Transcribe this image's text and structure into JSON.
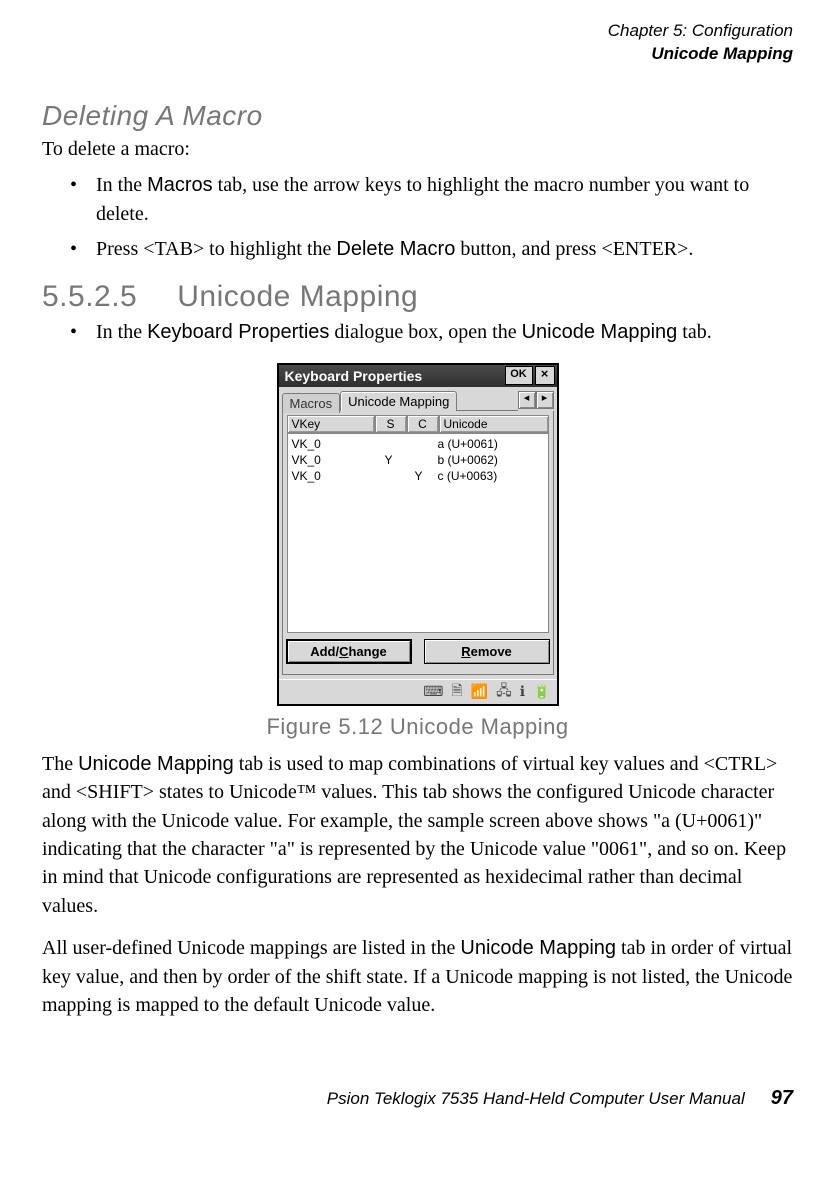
{
  "header": {
    "line1": "Chapter 5: Configuration",
    "line2": "Unicode Mapping"
  },
  "deleting": {
    "heading": "Deleting A Macro",
    "intro": "To delete a macro:",
    "bullets": [
      {
        "pre": "In the ",
        "ui": "Macros",
        "post": " tab, use the arrow keys to highlight the macro number you want to delete."
      },
      {
        "pre": "Press <TAB> to highlight the ",
        "ui": "Delete Macro",
        "post": " button, and press <ENTER>."
      }
    ]
  },
  "section": {
    "num": "5.5.2.5",
    "title": "Unicode Mapping",
    "bullet": {
      "pre": "In the ",
      "ui1": "Keyboard Properties",
      "mid": " dialogue box, open the ",
      "ui2": "Unicode Mapping",
      "post": " tab."
    }
  },
  "figure_caption": "Figure 5.12 Unicode Mapping",
  "paragraph1": {
    "pre": "The ",
    "ui": "Unicode Mapping",
    "post": " tab is used to map combinations of virtual key values and <CTRL> and <SHIFT> states to Unicode™ values. This tab shows the configured Unicode character along with the Unicode value. For example, the sample screen above shows \"a (U+0061)\" indicating that the character \"a\" is represented by the Unicode value \"0061\", and so on. Keep in mind that Unicode configurations are represented as hexidecimal rather than decimal values."
  },
  "paragraph2": {
    "pre": "All user-defined Unicode mappings are listed in the ",
    "ui": "Unicode Mapping",
    "post": " tab in order of virtual key value, and then by order of the shift state. If a Unicode mapping is not listed, the Unicode mapping is mapped to the default Unicode value."
  },
  "footer": {
    "manual": "Psion Teklogix 7535 Hand-Held Computer User Manual",
    "page": "97"
  },
  "dialog": {
    "title": "Keyboard Properties",
    "ok": "OK",
    "close": "×",
    "tabs": {
      "macros": "Macros",
      "unicode": "Unicode Mapping",
      "left": "◂",
      "right": "▸"
    },
    "columns": {
      "vkey": "VKey",
      "s": "S",
      "c": "C",
      "uni": "Unicode"
    },
    "rows": [
      {
        "vkey": "VK_0",
        "s": "",
        "c": "",
        "uni": "a (U+0061)"
      },
      {
        "vkey": "VK_0",
        "s": "Y",
        "c": "",
        "uni": "b (U+0062)"
      },
      {
        "vkey": "VK_0",
        "s": "",
        "c": "Y",
        "uni": "c (U+0063)"
      }
    ],
    "buttons": {
      "add_pre": "Add/",
      "add_u": "C",
      "add_post": "hange",
      "rem_u": "R",
      "rem_post": "emove"
    },
    "tray": {
      "i1": "⌨",
      "i2": "🗎",
      "i3": "📶",
      "i4": "🖧",
      "i5": "ℹ",
      "i6": "🔋"
    }
  }
}
